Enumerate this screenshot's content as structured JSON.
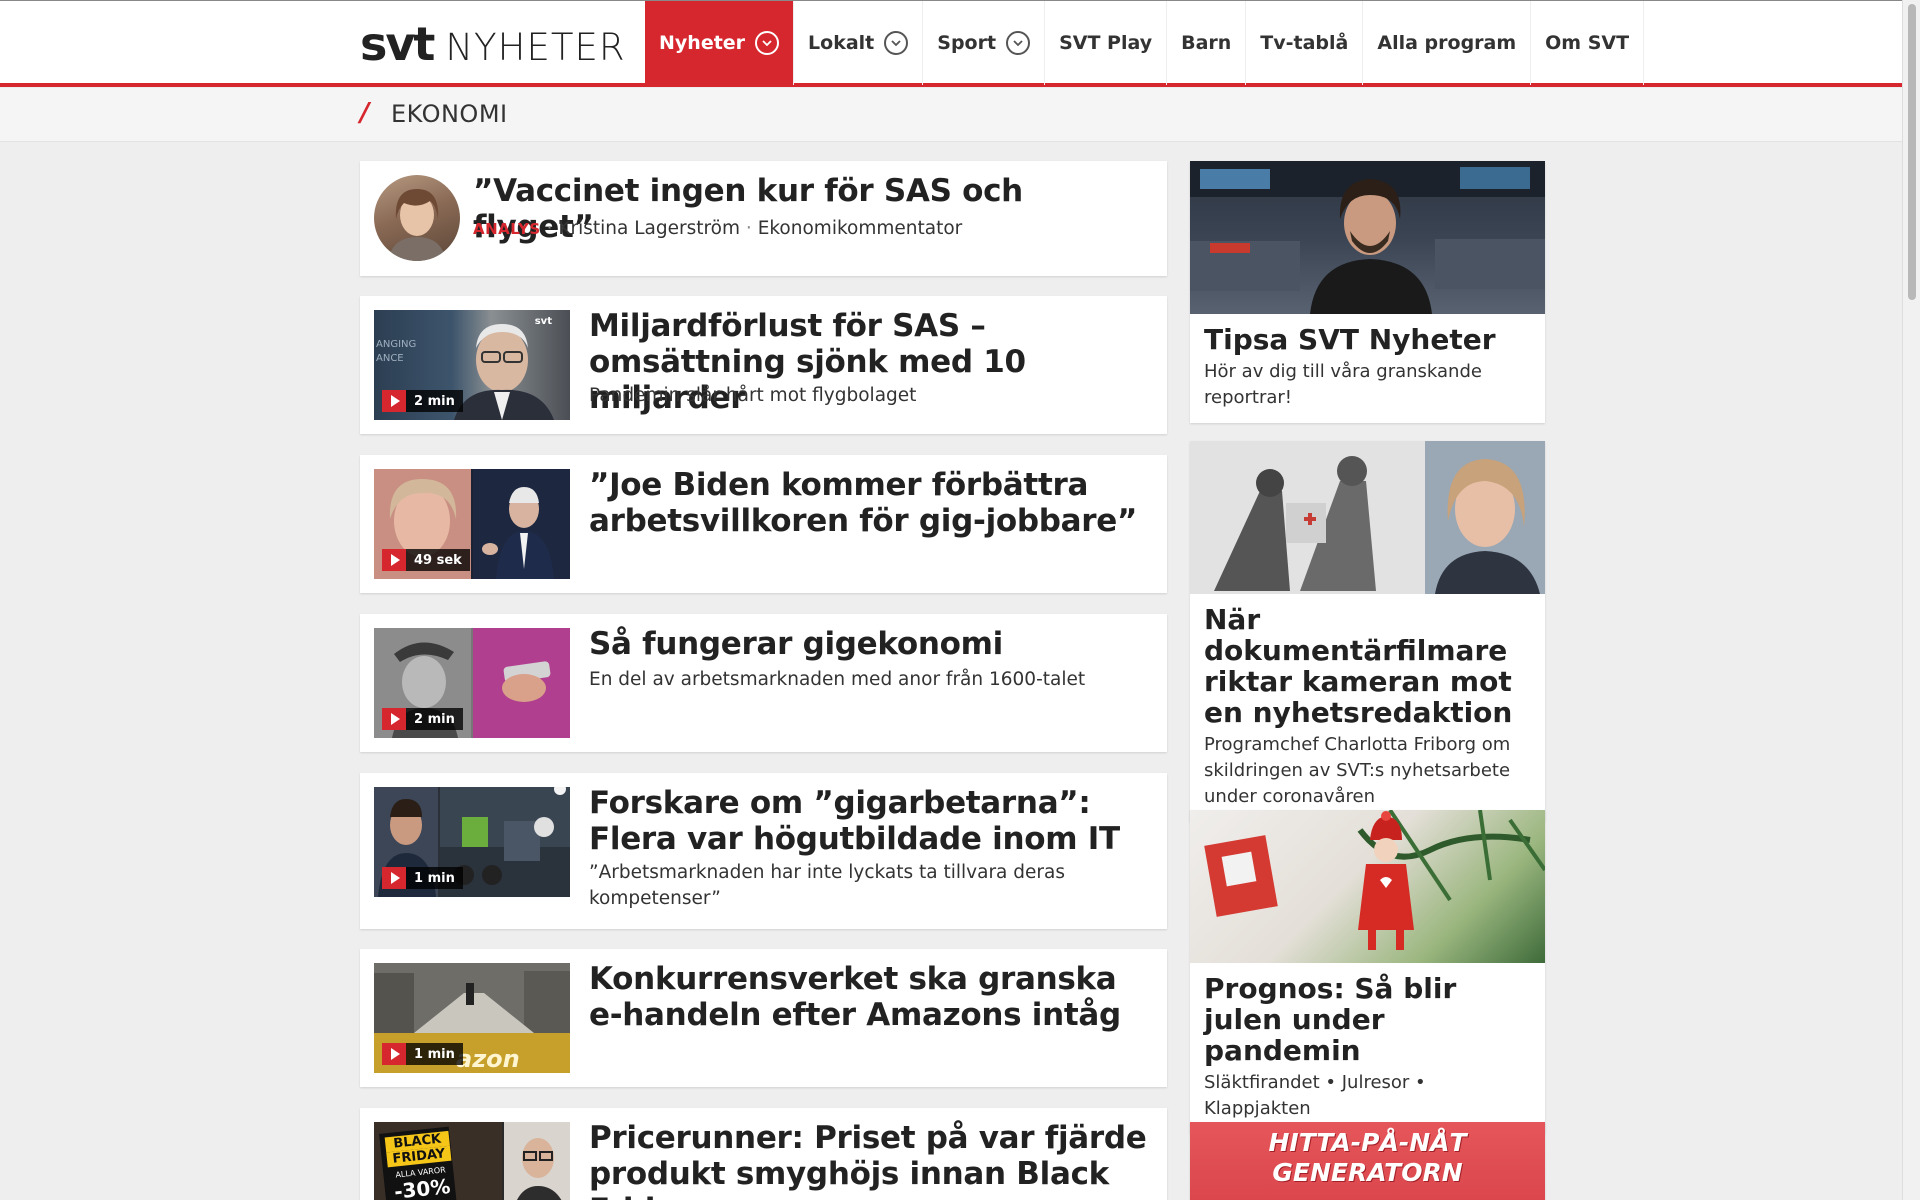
{
  "header": {
    "logo_svt": "svt",
    "logo_nyheter": "NYHETER",
    "nav": [
      {
        "label": "Nyheter",
        "dropdown": true,
        "active": true
      },
      {
        "label": "Lokalt",
        "dropdown": true,
        "active": false
      },
      {
        "label": "Sport",
        "dropdown": true,
        "active": false
      },
      {
        "label": "SVT Play",
        "dropdown": false,
        "active": false
      },
      {
        "label": "Barn",
        "dropdown": false,
        "active": false
      },
      {
        "label": "Tv-tablå",
        "dropdown": false,
        "active": false
      },
      {
        "label": "Alla program",
        "dropdown": false,
        "active": false
      },
      {
        "label": "Om SVT",
        "dropdown": false,
        "active": false
      }
    ]
  },
  "section": {
    "slash": "/",
    "title": "EKONOMI"
  },
  "articles": [
    {
      "title": "”Vaccinet ingen kur för SAS och flyget”",
      "kicker": "ANALYS",
      "separator": "·",
      "author": "Kristina Lagerström",
      "role": "Ekonomikommentator"
    },
    {
      "title": "Miljardförlust för SAS – omsättning sjönk med 10 miljarder",
      "subtitle": "Pandemin slår hårt mot flygbolaget",
      "duration": "2 min",
      "watermark": "svt",
      "bg_text": "ANGING ANCE"
    },
    {
      "title": "”Joe Biden kommer förbättra arbetsvillkoren för gig-jobbare”",
      "subtitle": "",
      "duration": "49 sek"
    },
    {
      "title": "Så fungerar gigekonomi",
      "subtitle": "En del av arbetsmarknaden med anor från 1600-talet",
      "duration": "2 min"
    },
    {
      "title": "Forskare om ”gigarbetarna”: Flera var högutbildade inom IT",
      "subtitle": "”Arbetsmarknaden har inte lyckats ta tillvara deras kompetenser”",
      "duration": "1 min"
    },
    {
      "title": "Konkurrensverket ska granska e-handeln efter Amazons intåg",
      "subtitle": "",
      "duration": "1 min",
      "brand_text": "azon"
    },
    {
      "title": "Pricerunner: Priset på var fjärde produkt smyghöjs innan Black Friday",
      "subtitle": "",
      "sign_text_1": "BLACK",
      "sign_text_2": "FRIDAY",
      "sign_text_3": "ALLA VAROR",
      "sign_text_4": "-30%"
    }
  ],
  "sidebar": [
    {
      "title": "Tipsa SVT Nyheter",
      "subtitle": "Hör av dig till våra granskande reportrar!"
    },
    {
      "title": "När dokumentärfilmare riktar kameran mot en nyhetsredaktion",
      "subtitle": "Programchef Charlotta Friborg om skildringen av SVT:s nyhetsarbete under coronavåren"
    },
    {
      "title": "Prognos: Så blir julen under pandemin",
      "subtitle": "Släktfirandet • Julresor • Klappjakten"
    },
    {
      "banner_line1": "HITTA-PÅ-NÅT",
      "banner_line2": "GENERATORN"
    }
  ],
  "colors": {
    "accent": "#d6262e",
    "background": "#eeeeee",
    "card": "#ffffff",
    "text": "#222222"
  }
}
